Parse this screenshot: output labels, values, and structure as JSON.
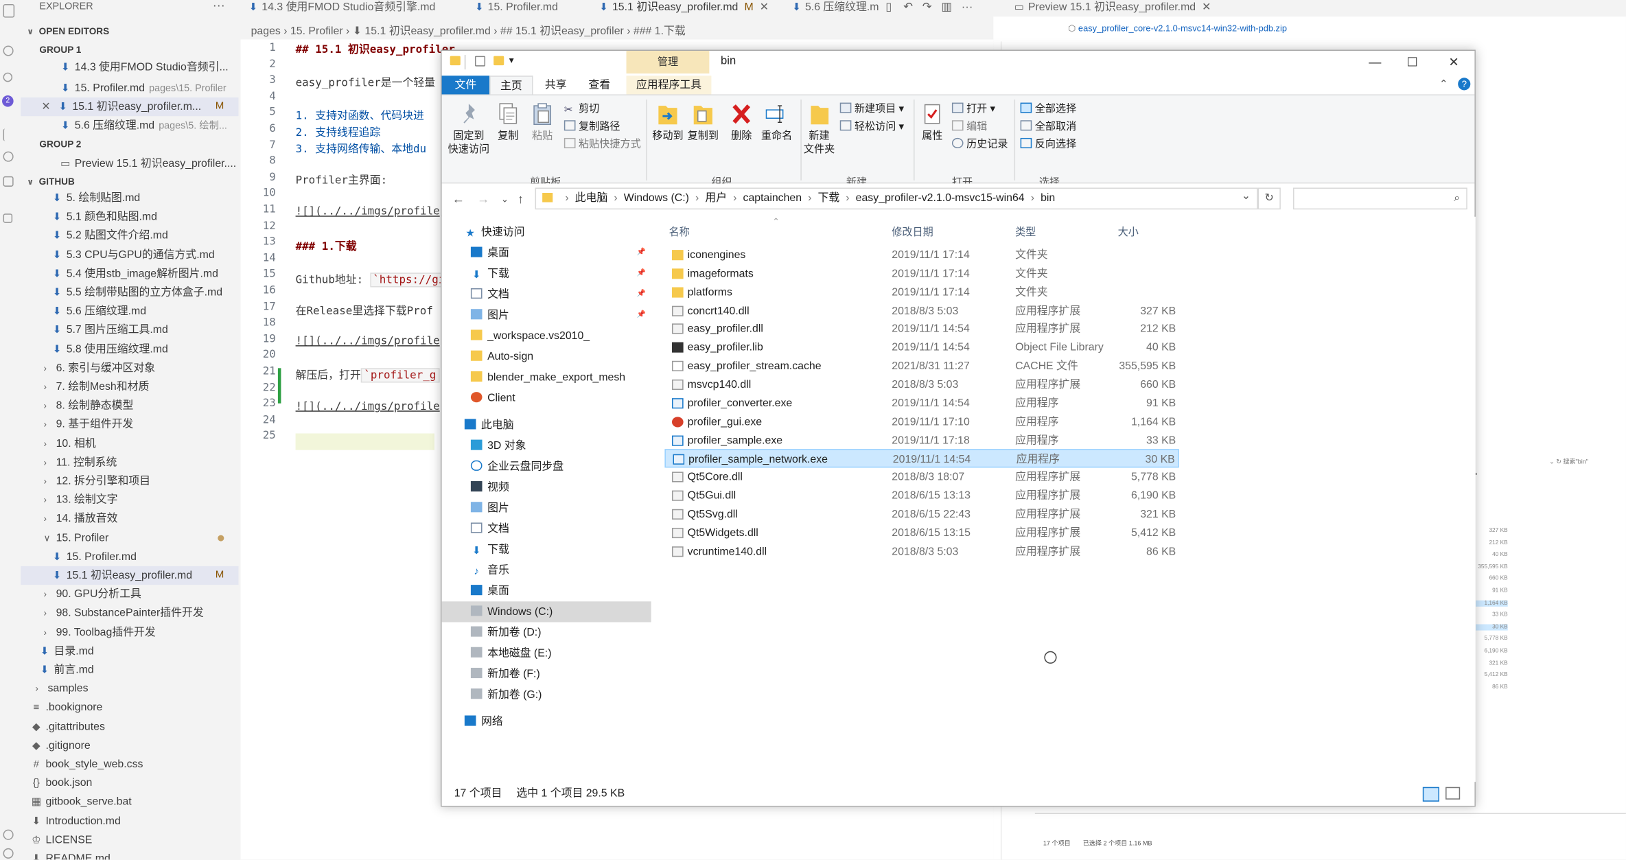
{
  "explorer": {
    "title": "EXPLORER",
    "more": "···",
    "open_editors_label": "OPEN EDITORS",
    "group1_label": "GROUP 1",
    "group2_label": "GROUP 2",
    "github_label": "GITHUB",
    "g1": [
      {
        "name": "14.3 使用FMOD Studio音频引...",
        "desc": "",
        "mod": ""
      },
      {
        "name": "15. Profiler.md",
        "desc": "pages\\15. Profiler",
        "mod": ""
      },
      {
        "name": "15.1 初识easy_profiler.m...",
        "desc": "",
        "mod": "M"
      },
      {
        "name": "5.6 压缩纹理.md",
        "desc": "pages\\5. 绘制...",
        "mod": ""
      }
    ],
    "g2": [
      {
        "name": "Preview 15.1 初识easy_profiler...."
      }
    ],
    "tree_files_5": [
      "5. 绘制贴图.md",
      "5.1 颜色和贴图.md",
      "5.2 贴图文件介绍.md",
      "5.3 CPU与GPU的通信方式.md",
      "5.4 使用stb_image解析图片.md",
      "5.5 绘制带贴图的立方体盒子.md",
      "5.6 压缩纹理.md",
      "5.7 图片压缩工具.md",
      "5.8 使用压缩纹理.md"
    ],
    "tree_folders": [
      "6. 索引与缓冲区对象",
      "7. 绘制Mesh和材质",
      "8. 绘制静态模型",
      "9. 基于组件开发",
      "10. 相机",
      "11. 控制系统",
      "12. 拆分引擎和项目",
      "13. 绘制文字",
      "14. 播放音效"
    ],
    "profiler_folder": "15. Profiler",
    "profiler_files": [
      {
        "name": "15. Profiler.md",
        "mod": ""
      },
      {
        "name": "15.1 初识easy_profiler.md",
        "mod": "M"
      }
    ],
    "tree_folders2": [
      "90. GPU分析工具",
      "98. SubstancePainter插件开发",
      "99. Toolbag插件开发"
    ],
    "tree_files2": [
      "目录.md",
      "前言.md"
    ],
    "samples": "samples",
    "root_files": [
      {
        "icon": "≡",
        "name": ".bookignore"
      },
      {
        "icon": "◆",
        "name": ".gitattributes"
      },
      {
        "icon": "◆",
        "name": ".gitignore"
      },
      {
        "icon": "#",
        "name": "book_style_web.css"
      },
      {
        "icon": "{}",
        "name": "book.json"
      },
      {
        "icon": "▦",
        "name": "gitbook_serve.bat"
      },
      {
        "icon": "⬇",
        "name": "Introduction.md"
      },
      {
        "icon": "♔",
        "name": "LICENSE"
      },
      {
        "icon": "⬇",
        "name": "README.md"
      }
    ]
  },
  "tabs": [
    {
      "label": "14.3 使用FMOD Studio音频引擎.md",
      "mod": ""
    },
    {
      "label": "15. Profiler.md",
      "mod": ""
    },
    {
      "label": "15.1 初识easy_profiler.md",
      "mod": "M"
    },
    {
      "label": "5.6 压缩纹理.m",
      "mod": ""
    },
    {
      "label": "Preview 15.1 初识easy_profiler.md",
      "mod": ""
    }
  ],
  "breadcrumb": "pages › 15. Profiler › ⬇ 15.1 初识easy_profiler.md › ## 15.1 初识easy_profiler › ### 1.下载",
  "editor": {
    "line_numbers": [
      "1",
      "2",
      "3",
      "4",
      "5",
      "6",
      "7",
      "8",
      "9",
      "10",
      "11",
      "12",
      "13",
      "14",
      "15",
      "16",
      "17",
      "18",
      "19",
      "20",
      "21",
      "22",
      "23",
      "24",
      "25"
    ],
    "l1": "## 15.1 初识easy_profiler",
    "l3": "easy_profiler是一个轻量",
    "l5": "1. 支持对函数、代码块进",
    "l6": "2. 支持线程追踪",
    "l7": "3. 支持网络传输、本地du",
    "l9": "Profiler主界面:",
    "l11": "![](../../imgs/profile",
    "l13": "### 1.下载",
    "l15a": "Github地址: ",
    "l15b": "`https://gi",
    "l17": "在Release里选择下载Prof",
    "l19": "![](../../imgs/profile",
    "l21a": "解压后，打开",
    "l21b": "`profiler_g",
    "l23": "![](../../imgs/profile"
  },
  "preview": {
    "link": "easy_profiler_core-v2.1.0-msvc14-win32-with-pdb.zip",
    "search": "搜索\"bin\"",
    "sizes": [
      "327 KB",
      "212 KB",
      "40 KB",
      "355,595 KB",
      "660 KB",
      "91 KB",
      "1,164 KB",
      "33 KB",
      "30 KB",
      "5,778 KB",
      "6,190 KB",
      "321 KB",
      "5,412 KB",
      "86 KB"
    ],
    "status_count": "17 个项目",
    "status_sel": "已选择 2 个项目  1.16 MB"
  },
  "fx": {
    "title": "bin",
    "manage": "管理",
    "qat": "▾",
    "win_min": "—",
    "win_max": "☐",
    "win_close": "✕",
    "help": "?",
    "collapse": "⌃",
    "ribbon_tabs": [
      "文件",
      "主页",
      "共享",
      "查看",
      "应用程序工具"
    ],
    "ribbon": {
      "pin": "固定到\n快速访问",
      "copy": "复制",
      "paste": "粘贴",
      "cut": "剪切",
      "copy_path": "复制路径",
      "paste_shortcut": "粘贴快捷方式",
      "move_to": "移动到",
      "copy_to": "复制到",
      "delete": "删除",
      "rename": "重命名",
      "new_folder": "新建\n文件夹",
      "new_item": "新建项目 ▾",
      "easy_access": "轻松访问 ▾",
      "properties": "属性",
      "open": "打开 ▾",
      "edit": "编辑",
      "history": "历史记录",
      "select_all": "全部选择",
      "select_none": "全部取消",
      "invert": "反向选择",
      "groups": [
        "剪贴板",
        "组织",
        "新建",
        "打开",
        "选择"
      ]
    },
    "address": [
      "此电脑",
      "Windows (C:)",
      "用户",
      "captainchen",
      "下载",
      "easy_profiler-v2.1.0-msvc15-win64",
      "bin"
    ],
    "nav": [
      {
        "label": "快速访问",
        "icon": "star",
        "pin": false,
        "indent": 1
      },
      {
        "label": "桌面",
        "icon": "desk",
        "pin": true,
        "indent": 2
      },
      {
        "label": "下载",
        "icon": "down",
        "pin": true,
        "indent": 2
      },
      {
        "label": "文档",
        "icon": "doc",
        "pin": true,
        "indent": 2
      },
      {
        "label": "图片",
        "icon": "pic",
        "pin": true,
        "indent": 2
      },
      {
        "label": "_workspace.vs2010_",
        "icon": "folder",
        "pin": false,
        "indent": 2
      },
      {
        "label": "Auto-sign",
        "icon": "folder",
        "pin": false,
        "indent": 2
      },
      {
        "label": "blender_make_export_mesh",
        "icon": "folder",
        "pin": false,
        "indent": 2
      },
      {
        "label": "Client",
        "icon": "client",
        "pin": false,
        "indent": 2
      },
      {
        "label": "此电脑",
        "icon": "pc",
        "pin": false,
        "indent": 1
      },
      {
        "label": "3D 对象",
        "icon": "obj3d",
        "pin": false,
        "indent": 2
      },
      {
        "label": "企业云盘同步盘",
        "icon": "cloud",
        "pin": false,
        "indent": 2
      },
      {
        "label": "视频",
        "icon": "video",
        "pin": false,
        "indent": 2
      },
      {
        "label": "图片",
        "icon": "pic",
        "pin": false,
        "indent": 2
      },
      {
        "label": "文档",
        "icon": "doc",
        "pin": false,
        "indent": 2
      },
      {
        "label": "下载",
        "icon": "down",
        "pin": false,
        "indent": 2
      },
      {
        "label": "音乐",
        "icon": "music",
        "pin": false,
        "indent": 2
      },
      {
        "label": "桌面",
        "icon": "desk",
        "pin": false,
        "indent": 2
      },
      {
        "label": "Windows (C:)",
        "icon": "drive",
        "pin": false,
        "indent": 2
      },
      {
        "label": "新加卷 (D:)",
        "icon": "drive",
        "pin": false,
        "indent": 2
      },
      {
        "label": "本地磁盘 (E:)",
        "icon": "drive",
        "pin": false,
        "indent": 2
      },
      {
        "label": "新加卷 (F:)",
        "icon": "drive",
        "pin": false,
        "indent": 2
      },
      {
        "label": "新加卷 (G:)",
        "icon": "drive",
        "pin": false,
        "indent": 2
      },
      {
        "label": "网络",
        "icon": "net",
        "pin": false,
        "indent": 1
      }
    ],
    "columns": {
      "name": "名称",
      "date": "修改日期",
      "type": "类型",
      "size": "大小"
    },
    "files": [
      {
        "name": "iconengines",
        "date": "2019/11/1 17:14",
        "type": "文件夹",
        "size": "",
        "icon": "folder"
      },
      {
        "name": "imageformats",
        "date": "2019/11/1 17:14",
        "type": "文件夹",
        "size": "",
        "icon": "folder"
      },
      {
        "name": "platforms",
        "date": "2019/11/1 17:14",
        "type": "文件夹",
        "size": "",
        "icon": "folder"
      },
      {
        "name": "concrt140.dll",
        "date": "2018/8/3 5:03",
        "type": "应用程序扩展",
        "size": "327 KB",
        "icon": "dll"
      },
      {
        "name": "easy_profiler.dll",
        "date": "2019/11/1 14:54",
        "type": "应用程序扩展",
        "size": "212 KB",
        "icon": "dll"
      },
      {
        "name": "easy_profiler.lib",
        "date": "2019/11/1 14:54",
        "type": "Object File Library",
        "size": "40 KB",
        "icon": "lib"
      },
      {
        "name": "easy_profiler_stream.cache",
        "date": "2021/8/31 11:27",
        "type": "CACHE 文件",
        "size": "355,595 KB",
        "icon": "file"
      },
      {
        "name": "msvcp140.dll",
        "date": "2018/8/3 5:03",
        "type": "应用程序扩展",
        "size": "660 KB",
        "icon": "dll"
      },
      {
        "name": "profiler_converter.exe",
        "date": "2019/11/1 14:54",
        "type": "应用程序",
        "size": "91 KB",
        "icon": "exe"
      },
      {
        "name": "profiler_gui.exe",
        "date": "2019/11/1 17:10",
        "type": "应用程序",
        "size": "1,164 KB",
        "icon": "gui"
      },
      {
        "name": "profiler_sample.exe",
        "date": "2019/11/1 17:18",
        "type": "应用程序",
        "size": "33 KB",
        "icon": "exe"
      },
      {
        "name": "profiler_sample_network.exe",
        "date": "2019/11/1 14:54",
        "type": "应用程序",
        "size": "30 KB",
        "icon": "exe",
        "selected": true
      },
      {
        "name": "Qt5Core.dll",
        "date": "2018/8/3 18:07",
        "type": "应用程序扩展",
        "size": "5,778 KB",
        "icon": "dll"
      },
      {
        "name": "Qt5Gui.dll",
        "date": "2018/6/15 13:13",
        "type": "应用程序扩展",
        "size": "6,190 KB",
        "icon": "dll"
      },
      {
        "name": "Qt5Svg.dll",
        "date": "2018/6/15 22:43",
        "type": "应用程序扩展",
        "size": "321 KB",
        "icon": "dll"
      },
      {
        "name": "Qt5Widgets.dll",
        "date": "2018/6/15 13:15",
        "type": "应用程序扩展",
        "size": "5,412 KB",
        "icon": "dll"
      },
      {
        "name": "vcruntime140.dll",
        "date": "2018/8/3 5:03",
        "type": "应用程序扩展",
        "size": "86 KB",
        "icon": "dll"
      }
    ],
    "status": {
      "count": "17 个项目",
      "selected": "选中 1 个项目  29.5 KB"
    }
  },
  "colors": {
    "accent": "#1979ca",
    "folder": "#f6c94c",
    "selection": "#cce8ff",
    "modified": "#895503"
  }
}
